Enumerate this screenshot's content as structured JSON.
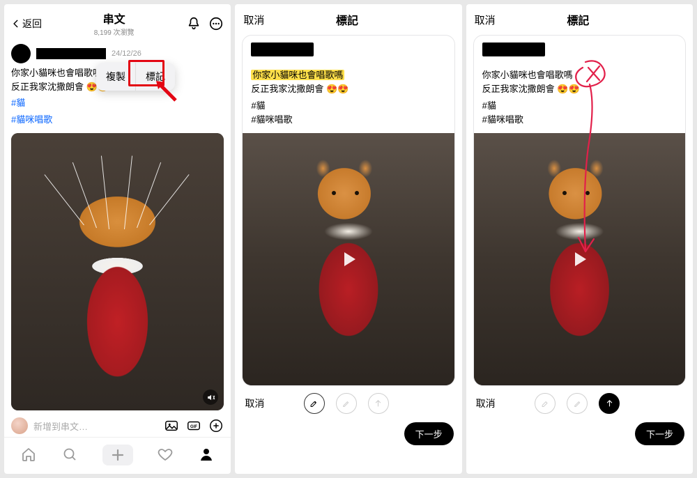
{
  "screen1": {
    "back": "返回",
    "title": "串文",
    "views": "8,199 次瀏覽",
    "date": "24/12/26",
    "line1": "你家小貓咪也會唱歌嗎",
    "line2": "反正我家沈撒朗會",
    "tag1": "#貓",
    "tag2": "#貓咪唱歌",
    "menu_copy": "複製",
    "menu_mark": "標記",
    "reply_placeholder": "新增到串文…"
  },
  "screen2": {
    "cancel": "取消",
    "title": "標記",
    "line1": "你家小貓咪也會唱歌嗎",
    "line2": "反正我家沈撒朗會",
    "tag1": "#貓",
    "tag2": "#貓咪唱歌",
    "bottom_cancel": "取消",
    "next": "下一步"
  },
  "screen3": {
    "cancel": "取消",
    "title": "標記",
    "line1": "你家小貓咪也會唱歌嗎",
    "line2": "反正我家沈撒朗會",
    "tag1": "#貓",
    "tag2": "#貓咪唱歌",
    "bottom_cancel": "取消",
    "next": "下一步"
  }
}
